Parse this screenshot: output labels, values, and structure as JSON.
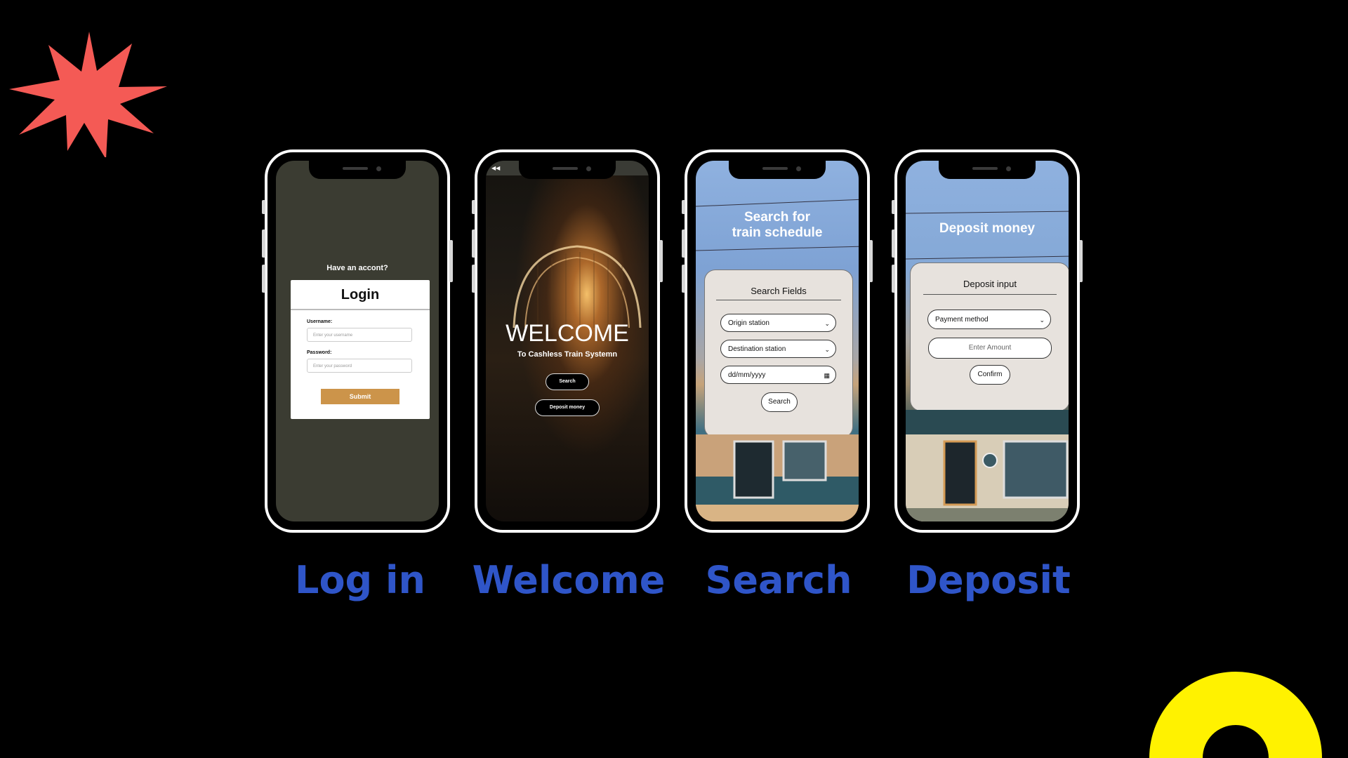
{
  "colors": {
    "background": "#000000",
    "caption": "#2f55c8",
    "starburst": "#f45a55",
    "arc": "#fff200",
    "login_screen_bg": "#3b3c32",
    "submit_button": "#cc944a",
    "panel_bg": "#e7e2dd"
  },
  "screens": {
    "login": {
      "caption": "Log in",
      "prompt": "Have an accont?",
      "card_title": "Login",
      "username_label": "Username:",
      "username_placeholder": "Enter your username",
      "password_label": "Password:",
      "password_placeholder": "Enter your password",
      "submit_label": "Submit"
    },
    "welcome": {
      "caption": "Welcome",
      "back_icon": "back-arrow-icon",
      "title": "WELCOME",
      "subtitle": "To Cashless Train Systemn",
      "search_button": "Search",
      "deposit_button": "Deposit money"
    },
    "search": {
      "caption": "Search",
      "title_line1": "Search for",
      "title_line2": "train schedule",
      "panel_title": "Search Fields",
      "origin_select": "Origin station",
      "destination_select": "Destination station",
      "date_input": "dd/mm/yyyy",
      "search_button": "Search"
    },
    "deposit": {
      "caption": "Deposit",
      "title": "Deposit money",
      "panel_title": "Deposit input",
      "payment_select": "Payment method",
      "amount_placeholder": "Enter Amount",
      "confirm_button": "Confirm"
    }
  }
}
